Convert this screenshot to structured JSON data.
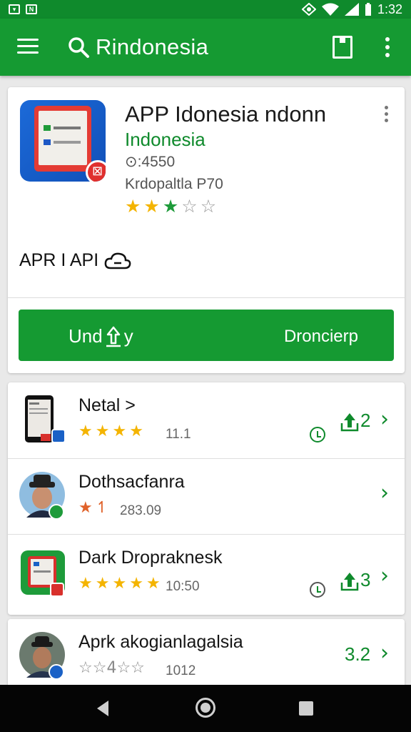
{
  "status_bar": {
    "time": "1:32",
    "left_icons": [
      "notification-icon",
      "app-icon"
    ],
    "right_icons": [
      "location-icon",
      "wifi-icon",
      "signal-icon",
      "battery-icon"
    ]
  },
  "app_bar": {
    "search_text": "Rindonesia",
    "icons": [
      "menu-icon",
      "search-icon",
      "bookmark-icon",
      "overflow-icon"
    ],
    "accent": "#159a32"
  },
  "hero": {
    "title": "APP Idonesia ndonn",
    "subtitle": "Indonesia",
    "meta1": "⊙:4550",
    "meta2": "Krdopaltla P70",
    "rating": 3,
    "stars_total": 5,
    "api_label": "APR I API",
    "button_left": "Und",
    "button_left_suffix": "y",
    "button_right": "Droncierp"
  },
  "list": [
    {
      "title": "Netal >",
      "rating": 4,
      "meta": "11.1",
      "downloads": "2",
      "thumb": "phone"
    },
    {
      "title": "Dothsacfanra",
      "rating": 1.5,
      "meta": "283.09",
      "downloads": "",
      "thumb": "person"
    },
    {
      "title": "Dark Dropraknesk",
      "rating": 5,
      "meta": "10:50",
      "downloads": "3",
      "thumb": "app"
    },
    {
      "title": "Aprk akogianlagalsia",
      "rating": 0,
      "meta": "1012",
      "downloads": "3.2",
      "thumb": "person2",
      "star_glyphs": "☆☆4☆☆"
    }
  ],
  "colors": {
    "green": "#0f8a2c",
    "star_gold": "#f4b400",
    "star_green": "#1e9b3a",
    "star_orange": "#e0622a"
  }
}
